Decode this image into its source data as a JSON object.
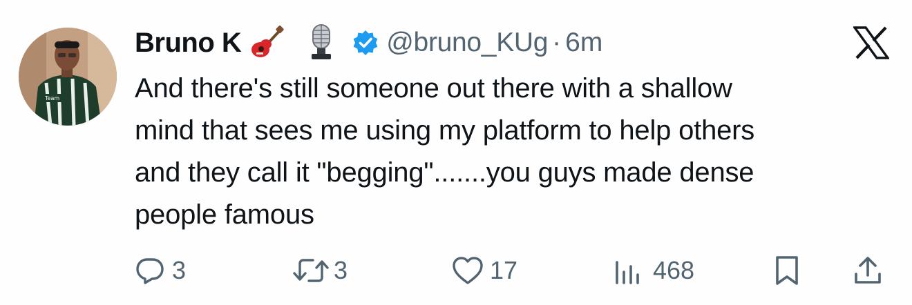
{
  "author": {
    "display_name": "Bruno K",
    "emojis": [
      "guitar-emoji",
      "microphone-emoji"
    ],
    "verified": true,
    "handle": "@bruno_KUg",
    "separator": "·",
    "time": "6m"
  },
  "tweet": {
    "text": "And there's still someone out there with a shallow\nmind that sees me using my platform to help others\nand they call it \"begging\".......you guys made dense\npeople famous"
  },
  "actions": {
    "reply_count": "3",
    "retweet_count": "3",
    "like_count": "17",
    "views_count": "468"
  },
  "colors": {
    "text": "#0f1419",
    "secondary": "#536471",
    "verified_blue": "#1d9bf0"
  },
  "icons": {
    "brand": "x-logo-icon",
    "reply": "reply-icon",
    "retweet": "retweet-icon",
    "like": "heart-icon",
    "views": "views-icon",
    "bookmark": "bookmark-icon",
    "share": "share-icon"
  }
}
